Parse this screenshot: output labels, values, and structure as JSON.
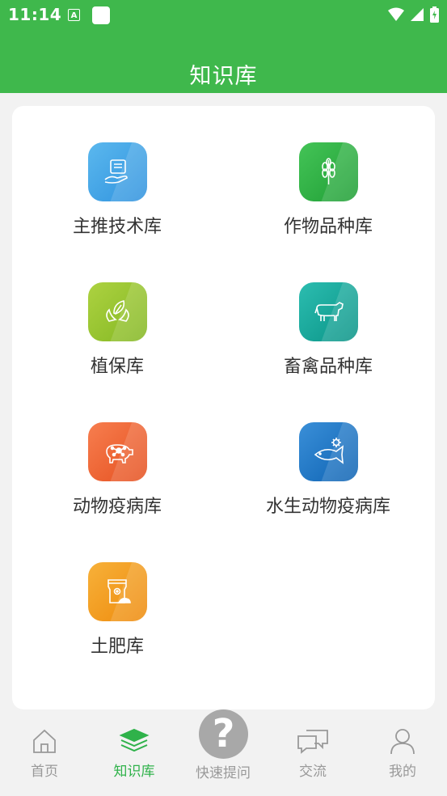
{
  "status": {
    "time": "11:14",
    "app_badge": "A"
  },
  "header": {
    "title": "知识库"
  },
  "grid": [
    {
      "label": "主推技术库",
      "icon": "hand-document-icon",
      "color": "#3ea3e6"
    },
    {
      "label": "作物品种库",
      "icon": "wheat-icon",
      "color": "#2bb040"
    },
    {
      "label": "植保库",
      "icon": "leaf-hand-icon",
      "color": "#96c52f"
    },
    {
      "label": "畜禽品种库",
      "icon": "cow-icon",
      "color": "#15a89a"
    },
    {
      "label": "动物疫病库",
      "icon": "pig-virus-icon",
      "color": "#f0623a"
    },
    {
      "label": "水生动物疫病库",
      "icon": "fish-virus-icon",
      "color": "#1b74c5"
    },
    {
      "label": "土肥库",
      "icon": "fertilizer-bag-icon",
      "color": "#f39a1b"
    }
  ],
  "tabs": [
    {
      "label": "首页",
      "icon": "home-icon",
      "active": false
    },
    {
      "label": "知识库",
      "icon": "layers-icon",
      "active": true
    },
    {
      "label": "快速提问",
      "icon": "question-icon",
      "active": false
    },
    {
      "label": "交流",
      "icon": "chat-icon",
      "active": false
    },
    {
      "label": "我的",
      "icon": "person-icon",
      "active": false
    }
  ],
  "colors": {
    "brand": "#3fb84c",
    "active_tab": "#2fb24a",
    "inactive_tab": "#999999"
  }
}
